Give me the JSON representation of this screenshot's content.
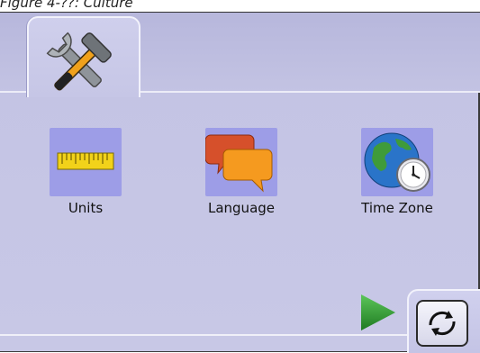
{
  "caption": {
    "text": "Figure 4-??: Culture"
  },
  "tabs": [
    {
      "icon": "tools-wrench-hammer-icon",
      "selected": true
    }
  ],
  "items": [
    {
      "label": "Units",
      "icon": "ruler-icon"
    },
    {
      "label": "Language",
      "icon": "speech-bubbles-icon"
    },
    {
      "label": "Time Zone",
      "icon": "globe-clock-icon"
    }
  ],
  "navigation": {
    "next_icon": "next-arrow-icon",
    "refresh_icon": "refresh-icon"
  },
  "colors": {
    "background": "#c4c4e4",
    "tile": "#9d9de7",
    "arrow": "#2f8f2f",
    "bubble_back": "#d6502b",
    "bubble_front": "#f59a1f"
  }
}
